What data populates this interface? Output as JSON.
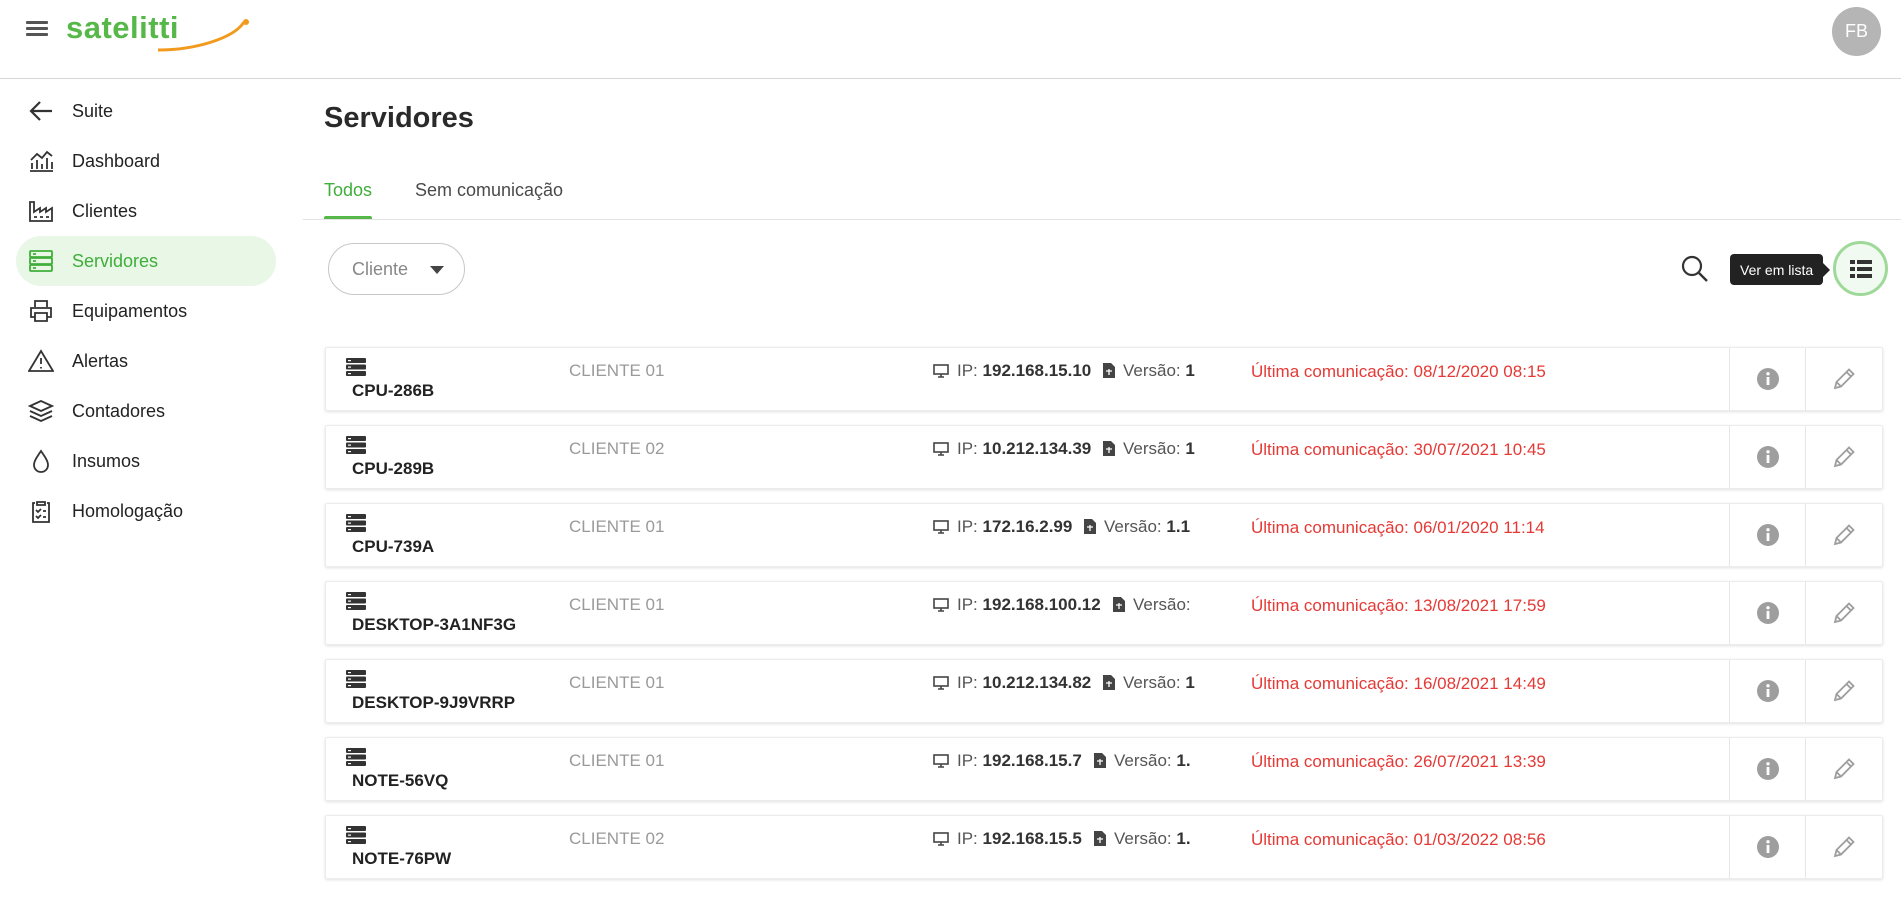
{
  "header": {
    "logo_text": "satelitti",
    "avatar_initials": "FB",
    "brand_color": "#55b848"
  },
  "sidebar": {
    "items": [
      {
        "label": "Suite",
        "icon": "arrow-left-icon"
      },
      {
        "label": "Dashboard",
        "icon": "chart-icon"
      },
      {
        "label": "Clientes",
        "icon": "factory-icon"
      },
      {
        "label": "Servidores",
        "icon": "server-icon",
        "active": true
      },
      {
        "label": "Equipamentos",
        "icon": "printer-icon"
      },
      {
        "label": "Alertas",
        "icon": "warning-icon"
      },
      {
        "label": "Contadores",
        "icon": "layers-icon"
      },
      {
        "label": "Insumos",
        "icon": "drop-icon"
      },
      {
        "label": "Homologação",
        "icon": "clipboard-icon"
      }
    ]
  },
  "main": {
    "title": "Servidores",
    "tabs": [
      {
        "label": "Todos",
        "active": true
      },
      {
        "label": "Sem comunicação",
        "active": false
      }
    ],
    "filter": {
      "label": "Cliente"
    },
    "tooltip": "Ver em lista",
    "ip_label": "IP:",
    "version_label": "Versão:",
    "servers": [
      {
        "name": "CPU-286B",
        "client": "CLIENTE 01",
        "ip": "192.168.15.10",
        "version": "1",
        "last": "Última comunicação: 08/12/2020 08:15"
      },
      {
        "name": "CPU-289B",
        "client": "CLIENTE 02",
        "ip": "10.212.134.39",
        "version": "1",
        "last": "Última comunicação: 30/07/2021 10:45"
      },
      {
        "name": "CPU-739A",
        "client": "CLIENTE 01",
        "ip": "172.16.2.99",
        "version": "1.1",
        "last": "Última comunicação: 06/01/2020 11:14"
      },
      {
        "name": "DESKTOP-3A1NF3G",
        "client": "CLIENTE 01",
        "ip": "192.168.100.12",
        "version": "",
        "last": "Última comunicação: 13/08/2021 17:59"
      },
      {
        "name": "DESKTOP-9J9VRRP",
        "client": "CLIENTE 01",
        "ip": "10.212.134.82",
        "version": "1",
        "last": "Última comunicação: 16/08/2021 14:49"
      },
      {
        "name": "NOTE-56VQ",
        "client": "CLIENTE 01",
        "ip": "192.168.15.7",
        "version": "1.",
        "last": "Última comunicação: 26/07/2021 13:39"
      },
      {
        "name": "NOTE-76PW",
        "client": "CLIENTE 02",
        "ip": "192.168.15.5",
        "version": "1.",
        "last": "Última comunicação: 01/03/2022 08:56"
      }
    ]
  }
}
